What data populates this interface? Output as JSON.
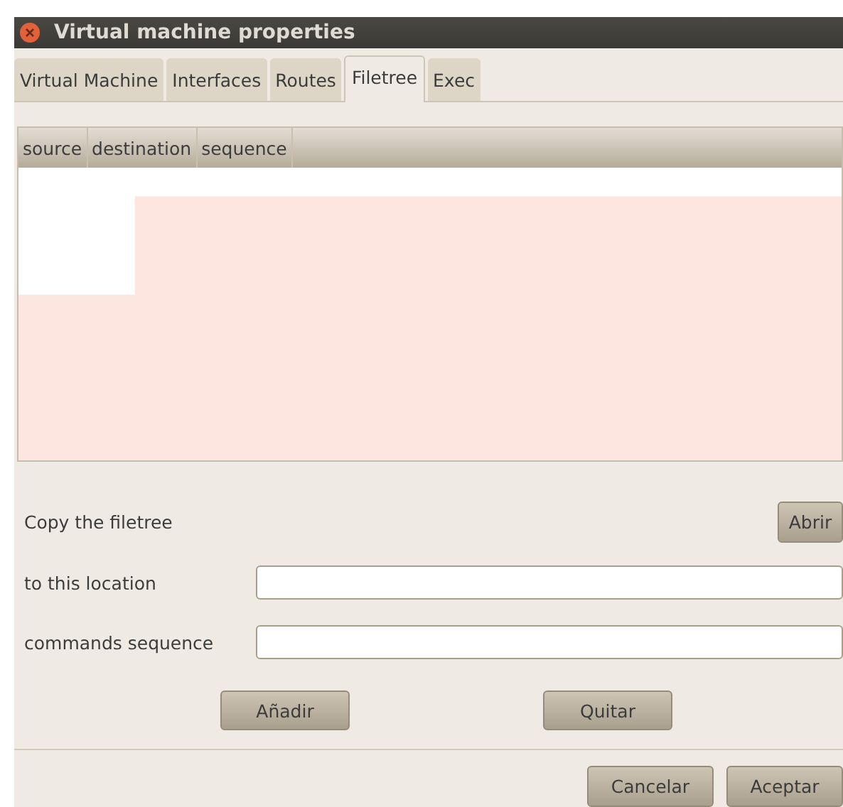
{
  "window": {
    "title": "Virtual machine properties"
  },
  "tabs": [
    {
      "label": "Virtual Machine",
      "selected": false
    },
    {
      "label": "Interfaces",
      "selected": false
    },
    {
      "label": "Routes",
      "selected": false
    },
    {
      "label": "Filetree",
      "selected": true
    },
    {
      "label": "Exec",
      "selected": false
    }
  ],
  "table": {
    "columns": [
      "source",
      "destination",
      "sequence"
    ]
  },
  "form": {
    "open_label": "Copy the filetree",
    "open_button": "Abrir",
    "fields": [
      {
        "label": "to this location"
      },
      {
        "label": "commands sequence"
      }
    ],
    "add_button": "Añadir",
    "remove_button": "Quitar"
  },
  "buttons": [
    "Cancelar",
    "Aceptar"
  ]
}
